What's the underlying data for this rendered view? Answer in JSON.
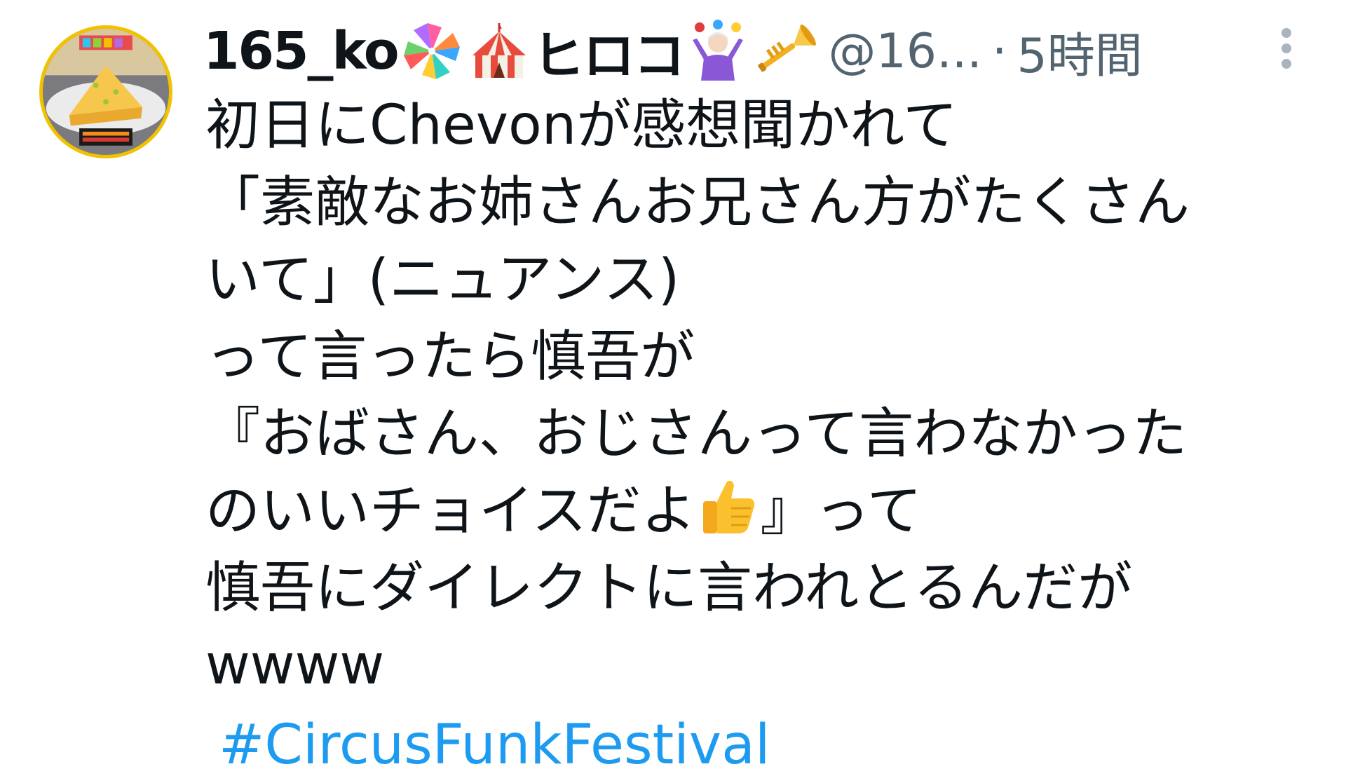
{
  "tweet": {
    "display_name_prefix": "165_ko",
    "display_name_middle": "ヒロコ",
    "handle": "@16...",
    "separator": "·",
    "time": "5時間",
    "avatar_icon": "birthday-cake-photo",
    "name_icons": [
      "pinwheel-icon",
      "circus-tent-icon",
      "juggler-icon",
      "trumpet-icon"
    ],
    "lines": [
      "初日にChevonが感想聞かれて",
      "「素敵なお姉さんお兄さん方がたくさん",
      "いて」(ニュアンス)",
      "って言ったら慎吾が",
      "『おばさん、おじさんって言わなかった",
      "のいいチョイスだよ",
      "』って",
      "慎吾にダイレクトに言われとるんだが",
      "wwww"
    ],
    "thumbs_icon": "thumbs-up-icon",
    "hashtag": "#CircusFunkFestival"
  },
  "colors": {
    "text": "#0f1419",
    "secondary": "#536471",
    "link": "#1d9bf0",
    "avatar_ring": "#f2c200"
  }
}
